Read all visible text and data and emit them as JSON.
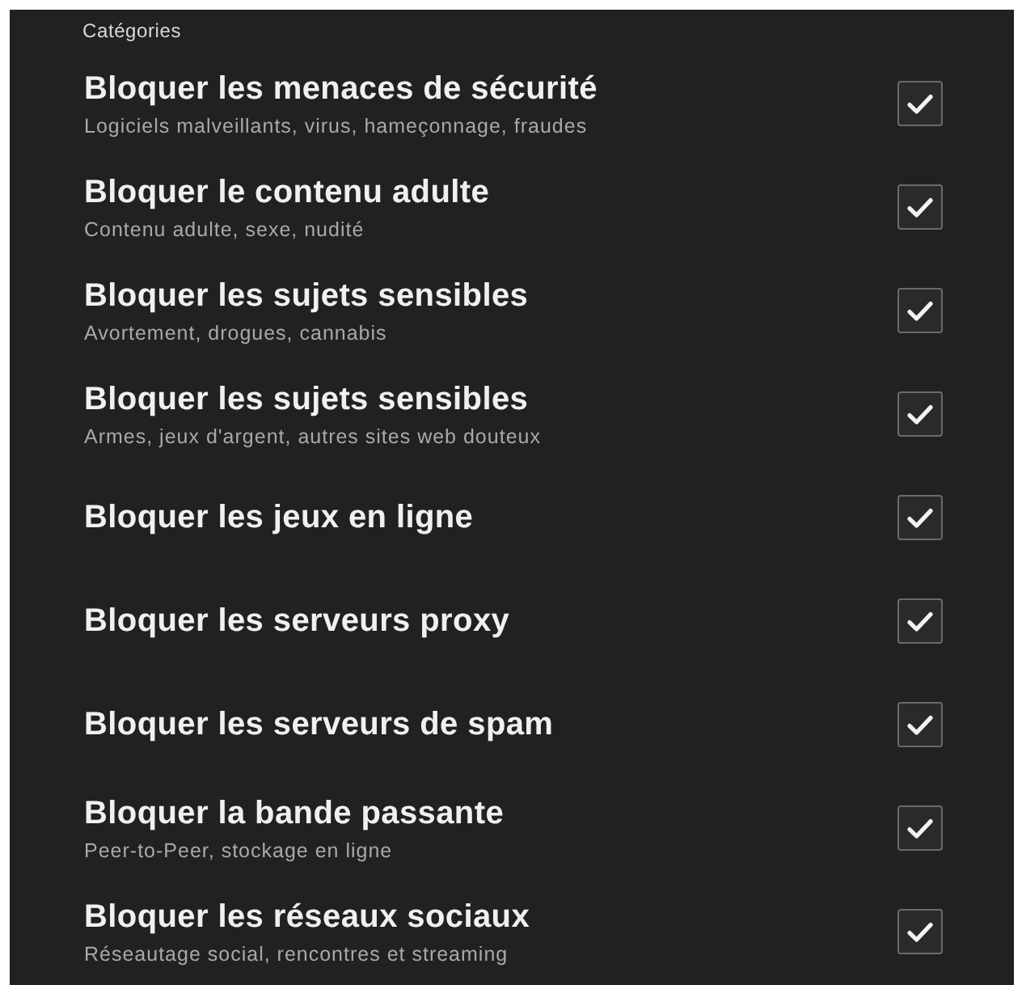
{
  "section": {
    "title": "Catégories"
  },
  "categories": [
    {
      "title": "Bloquer les menaces de sécurité",
      "description": "Logiciels malveillants, virus, hameçonnage, fraudes",
      "checked": true
    },
    {
      "title": "Bloquer le contenu adulte",
      "description": "Contenu adulte, sexe, nudité",
      "checked": true
    },
    {
      "title": "Bloquer les sujets sensibles",
      "description": "Avortement, drogues, cannabis",
      "checked": true
    },
    {
      "title": "Bloquer les sujets sensibles",
      "description": "Armes, jeux d'argent, autres sites web douteux",
      "checked": true
    },
    {
      "title": "Bloquer les jeux en ligne",
      "checked": true
    },
    {
      "title": "Bloquer les serveurs proxy",
      "checked": true
    },
    {
      "title": "Bloquer les serveurs de spam",
      "checked": true
    },
    {
      "title": "Bloquer la bande passante",
      "description": "Peer-to-Peer, stockage en ligne",
      "checked": true
    },
    {
      "title": "Bloquer les réseaux sociaux",
      "description": "Réseautage social, rencontres et streaming",
      "checked": true
    }
  ]
}
